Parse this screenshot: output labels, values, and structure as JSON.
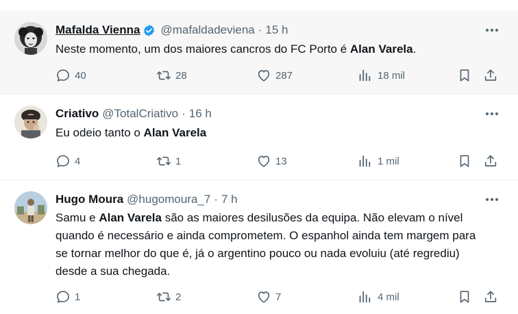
{
  "tweets": [
    {
      "name": "Mafalda Vienna",
      "verified": true,
      "handle": "@mafaldadeviena",
      "dot": "·",
      "time": "15 h",
      "text_parts": [
        "Neste momento, um dos maiores cancros do FC Porto é ",
        "Alan Varela",
        "."
      ],
      "replies": "40",
      "retweets": "28",
      "likes": "287",
      "views": "18 mil"
    },
    {
      "name": "Criativo",
      "verified": false,
      "handle": "@TotalCriativo",
      "dot": "·",
      "time": "16 h",
      "text_parts": [
        "Eu odeio tanto o ",
        "Alan Varela",
        ""
      ],
      "replies": "4",
      "retweets": "1",
      "likes": "13",
      "views": "1 mil"
    },
    {
      "name": "Hugo Moura",
      "verified": false,
      "handle": "@hugomoura_7",
      "dot": "·",
      "time": "7 h",
      "text_parts": [
        "Samu e ",
        "Alan Varela",
        " são as maiores desilusões da equipa. Não elevam o nível quando é necessário e ainda comprometem. O espanhol ainda tem margem para se tornar melhor do que é, já o argentino pouco ou nada evoluiu (até regrediu) desde a sua chegada."
      ],
      "replies": "1",
      "retweets": "2",
      "likes": "7",
      "views": "4 mil"
    }
  ],
  "colors": {
    "verified": "#1d9bf0",
    "icon": "#536471",
    "highlight_bg": "#f7f7f7",
    "divider": "#eff3f4"
  }
}
